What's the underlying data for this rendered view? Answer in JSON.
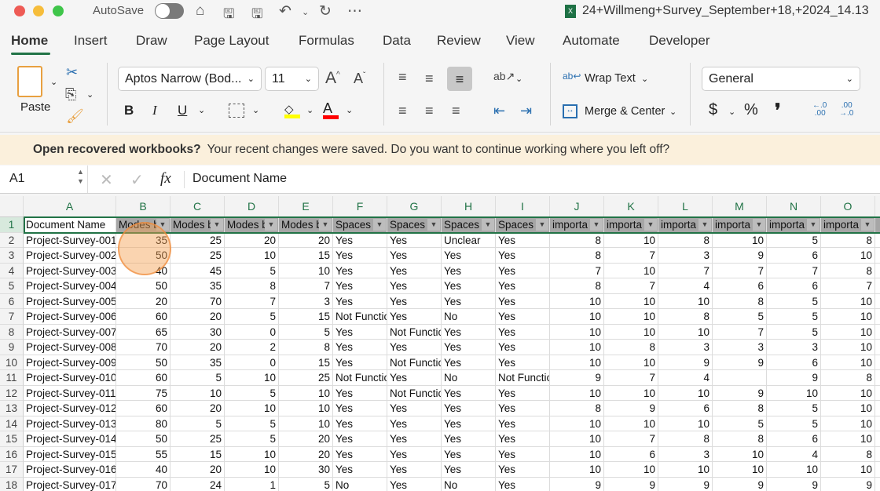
{
  "window": {
    "title": "24+Willmeng+Survey_September+18,+2024_14.13",
    "autosave_label": "AutoSave",
    "autosave_on": false
  },
  "tabs": [
    "Home",
    "Insert",
    "Draw",
    "Page Layout",
    "Formulas",
    "Data",
    "Review",
    "View",
    "Automate",
    "Developer"
  ],
  "active_tab": "Home",
  "ribbon": {
    "paste_label": "Paste",
    "font_name": "Aptos Narrow (Bod...",
    "font_size": "11",
    "wrap_text": "Wrap Text",
    "merge_center": "Merge & Center",
    "number_format": "General",
    "bold": "B",
    "italic": "I",
    "underline": "U",
    "currency": "$",
    "percent": "%",
    "comma": "❜",
    "fill_color": "#ffff00",
    "font_color": "#ff0000"
  },
  "banner": {
    "title": "Open recovered workbooks?",
    "message": "Your recent changes were saved. Do you want to continue working where you left off?"
  },
  "formula_bar": {
    "name_box": "A1",
    "fx": "fx",
    "value": "Document Name"
  },
  "columns": [
    "A",
    "B",
    "C",
    "D",
    "E",
    "F",
    "G",
    "H",
    "I",
    "J",
    "K",
    "L",
    "M",
    "N",
    "O"
  ],
  "header_row": [
    "Document Name",
    "Modes b",
    "Modes b",
    "Modes b",
    "Modes b",
    "Spaces f",
    "Spaces f",
    "Spaces f",
    "Spaces f",
    "importa",
    "importa",
    "importa",
    "importa",
    "importa",
    "importa"
  ],
  "rows": [
    [
      "Project-Survey-001",
      "35",
      "25",
      "20",
      "20",
      "Yes",
      "Yes",
      "Unclear",
      "Yes",
      "8",
      "10",
      "8",
      "10",
      "5",
      "8"
    ],
    [
      "Project-Survey-002",
      "50",
      "25",
      "10",
      "15",
      "Yes",
      "Yes",
      "Yes",
      "Yes",
      "8",
      "7",
      "3",
      "9",
      "6",
      "10"
    ],
    [
      "Project-Survey-003",
      "40",
      "45",
      "5",
      "10",
      "Yes",
      "Yes",
      "Yes",
      "Yes",
      "7",
      "10",
      "7",
      "7",
      "7",
      "8"
    ],
    [
      "Project-Survey-004",
      "50",
      "35",
      "8",
      "7",
      "Yes",
      "Yes",
      "Yes",
      "Yes",
      "8",
      "7",
      "4",
      "6",
      "6",
      "7"
    ],
    [
      "Project-Survey-005",
      "20",
      "70",
      "7",
      "3",
      "Yes",
      "Yes",
      "Yes",
      "Yes",
      "10",
      "10",
      "10",
      "8",
      "5",
      "10"
    ],
    [
      "Project-Survey-006",
      "60",
      "20",
      "5",
      "15",
      "Not Functio",
      "Yes",
      "No",
      "Yes",
      "10",
      "10",
      "8",
      "5",
      "5",
      "10"
    ],
    [
      "Project-Survey-007",
      "65",
      "30",
      "0",
      "5",
      "Yes",
      "Not Functio",
      "Yes",
      "Yes",
      "10",
      "10",
      "10",
      "7",
      "5",
      "10"
    ],
    [
      "Project-Survey-008",
      "70",
      "20",
      "2",
      "8",
      "Yes",
      "Yes",
      "Yes",
      "Yes",
      "10",
      "8",
      "3",
      "3",
      "3",
      "10"
    ],
    [
      "Project-Survey-009",
      "50",
      "35",
      "0",
      "15",
      "Yes",
      "Not Functio",
      "Yes",
      "Yes",
      "10",
      "10",
      "9",
      "9",
      "6",
      "10"
    ],
    [
      "Project-Survey-010",
      "60",
      "5",
      "10",
      "25",
      "Not Functio",
      "Yes",
      "No",
      "Not Functio",
      "9",
      "7",
      "4",
      "",
      "9",
      "8"
    ],
    [
      "Project-Survey-011",
      "75",
      "10",
      "5",
      "10",
      "Yes",
      "Not Functio",
      "Yes",
      "Yes",
      "10",
      "10",
      "10",
      "9",
      "10",
      "10"
    ],
    [
      "Project-Survey-012",
      "60",
      "20",
      "10",
      "10",
      "Yes",
      "Yes",
      "Yes",
      "Yes",
      "8",
      "9",
      "6",
      "8",
      "5",
      "10"
    ],
    [
      "Project-Survey-013",
      "80",
      "5",
      "5",
      "10",
      "Yes",
      "Yes",
      "Yes",
      "Yes",
      "10",
      "10",
      "10",
      "5",
      "5",
      "10"
    ],
    [
      "Project-Survey-014",
      "50",
      "25",
      "5",
      "20",
      "Yes",
      "Yes",
      "Yes",
      "Yes",
      "10",
      "7",
      "8",
      "8",
      "6",
      "10"
    ],
    [
      "Project-Survey-015",
      "55",
      "15",
      "10",
      "20",
      "Yes",
      "Yes",
      "Yes",
      "Yes",
      "10",
      "6",
      "3",
      "10",
      "4",
      "8"
    ],
    [
      "Project-Survey-016",
      "40",
      "20",
      "10",
      "30",
      "Yes",
      "Yes",
      "Yes",
      "Yes",
      "10",
      "10",
      "10",
      "10",
      "10",
      "10"
    ],
    [
      "Project-Survey-017",
      "70",
      "24",
      "1",
      "5",
      "No",
      "Yes",
      "No",
      "Yes",
      "9",
      "9",
      "9",
      "9",
      "9",
      "9"
    ]
  ],
  "colors": {
    "accent": "#217346",
    "header_fill": "#a6a6a6",
    "banner": "#fbf0dc",
    "click_marker": "#f5a050"
  }
}
